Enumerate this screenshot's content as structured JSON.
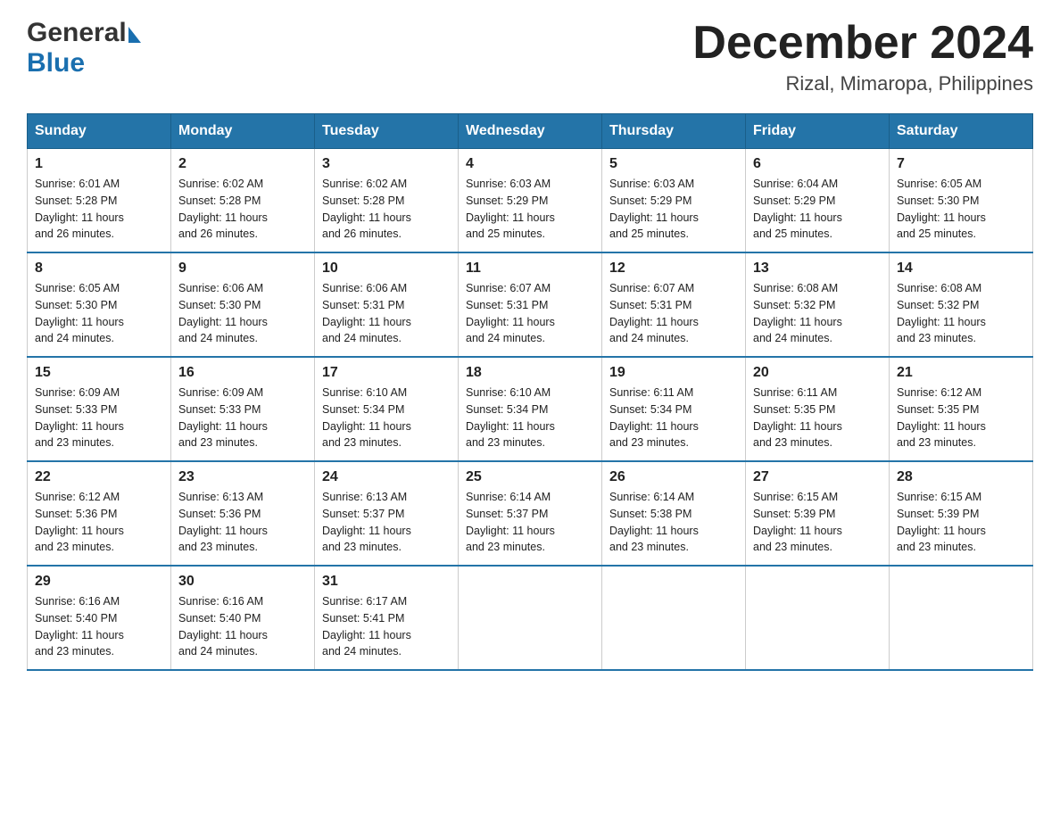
{
  "header": {
    "logo_general": "General",
    "logo_blue": "Blue",
    "month_title": "December 2024",
    "location": "Rizal, Mimaropa, Philippines"
  },
  "days_of_week": [
    "Sunday",
    "Monday",
    "Tuesday",
    "Wednesday",
    "Thursday",
    "Friday",
    "Saturday"
  ],
  "weeks": [
    [
      {
        "day": "1",
        "sunrise": "6:01 AM",
        "sunset": "5:28 PM",
        "daylight": "11 hours and 26 minutes."
      },
      {
        "day": "2",
        "sunrise": "6:02 AM",
        "sunset": "5:28 PM",
        "daylight": "11 hours and 26 minutes."
      },
      {
        "day": "3",
        "sunrise": "6:02 AM",
        "sunset": "5:28 PM",
        "daylight": "11 hours and 26 minutes."
      },
      {
        "day": "4",
        "sunrise": "6:03 AM",
        "sunset": "5:29 PM",
        "daylight": "11 hours and 25 minutes."
      },
      {
        "day": "5",
        "sunrise": "6:03 AM",
        "sunset": "5:29 PM",
        "daylight": "11 hours and 25 minutes."
      },
      {
        "day": "6",
        "sunrise": "6:04 AM",
        "sunset": "5:29 PM",
        "daylight": "11 hours and 25 minutes."
      },
      {
        "day": "7",
        "sunrise": "6:05 AM",
        "sunset": "5:30 PM",
        "daylight": "11 hours and 25 minutes."
      }
    ],
    [
      {
        "day": "8",
        "sunrise": "6:05 AM",
        "sunset": "5:30 PM",
        "daylight": "11 hours and 24 minutes."
      },
      {
        "day": "9",
        "sunrise": "6:06 AM",
        "sunset": "5:30 PM",
        "daylight": "11 hours and 24 minutes."
      },
      {
        "day": "10",
        "sunrise": "6:06 AM",
        "sunset": "5:31 PM",
        "daylight": "11 hours and 24 minutes."
      },
      {
        "day": "11",
        "sunrise": "6:07 AM",
        "sunset": "5:31 PM",
        "daylight": "11 hours and 24 minutes."
      },
      {
        "day": "12",
        "sunrise": "6:07 AM",
        "sunset": "5:31 PM",
        "daylight": "11 hours and 24 minutes."
      },
      {
        "day": "13",
        "sunrise": "6:08 AM",
        "sunset": "5:32 PM",
        "daylight": "11 hours and 24 minutes."
      },
      {
        "day": "14",
        "sunrise": "6:08 AM",
        "sunset": "5:32 PM",
        "daylight": "11 hours and 23 minutes."
      }
    ],
    [
      {
        "day": "15",
        "sunrise": "6:09 AM",
        "sunset": "5:33 PM",
        "daylight": "11 hours and 23 minutes."
      },
      {
        "day": "16",
        "sunrise": "6:09 AM",
        "sunset": "5:33 PM",
        "daylight": "11 hours and 23 minutes."
      },
      {
        "day": "17",
        "sunrise": "6:10 AM",
        "sunset": "5:34 PM",
        "daylight": "11 hours and 23 minutes."
      },
      {
        "day": "18",
        "sunrise": "6:10 AM",
        "sunset": "5:34 PM",
        "daylight": "11 hours and 23 minutes."
      },
      {
        "day": "19",
        "sunrise": "6:11 AM",
        "sunset": "5:34 PM",
        "daylight": "11 hours and 23 minutes."
      },
      {
        "day": "20",
        "sunrise": "6:11 AM",
        "sunset": "5:35 PM",
        "daylight": "11 hours and 23 minutes."
      },
      {
        "day": "21",
        "sunrise": "6:12 AM",
        "sunset": "5:35 PM",
        "daylight": "11 hours and 23 minutes."
      }
    ],
    [
      {
        "day": "22",
        "sunrise": "6:12 AM",
        "sunset": "5:36 PM",
        "daylight": "11 hours and 23 minutes."
      },
      {
        "day": "23",
        "sunrise": "6:13 AM",
        "sunset": "5:36 PM",
        "daylight": "11 hours and 23 minutes."
      },
      {
        "day": "24",
        "sunrise": "6:13 AM",
        "sunset": "5:37 PM",
        "daylight": "11 hours and 23 minutes."
      },
      {
        "day": "25",
        "sunrise": "6:14 AM",
        "sunset": "5:37 PM",
        "daylight": "11 hours and 23 minutes."
      },
      {
        "day": "26",
        "sunrise": "6:14 AM",
        "sunset": "5:38 PM",
        "daylight": "11 hours and 23 minutes."
      },
      {
        "day": "27",
        "sunrise": "6:15 AM",
        "sunset": "5:39 PM",
        "daylight": "11 hours and 23 minutes."
      },
      {
        "day": "28",
        "sunrise": "6:15 AM",
        "sunset": "5:39 PM",
        "daylight": "11 hours and 23 minutes."
      }
    ],
    [
      {
        "day": "29",
        "sunrise": "6:16 AM",
        "sunset": "5:40 PM",
        "daylight": "11 hours and 23 minutes."
      },
      {
        "day": "30",
        "sunrise": "6:16 AM",
        "sunset": "5:40 PM",
        "daylight": "11 hours and 24 minutes."
      },
      {
        "day": "31",
        "sunrise": "6:17 AM",
        "sunset": "5:41 PM",
        "daylight": "11 hours and 24 minutes."
      },
      null,
      null,
      null,
      null
    ]
  ],
  "labels": {
    "sunrise": "Sunrise:",
    "sunset": "Sunset:",
    "daylight": "Daylight:"
  }
}
